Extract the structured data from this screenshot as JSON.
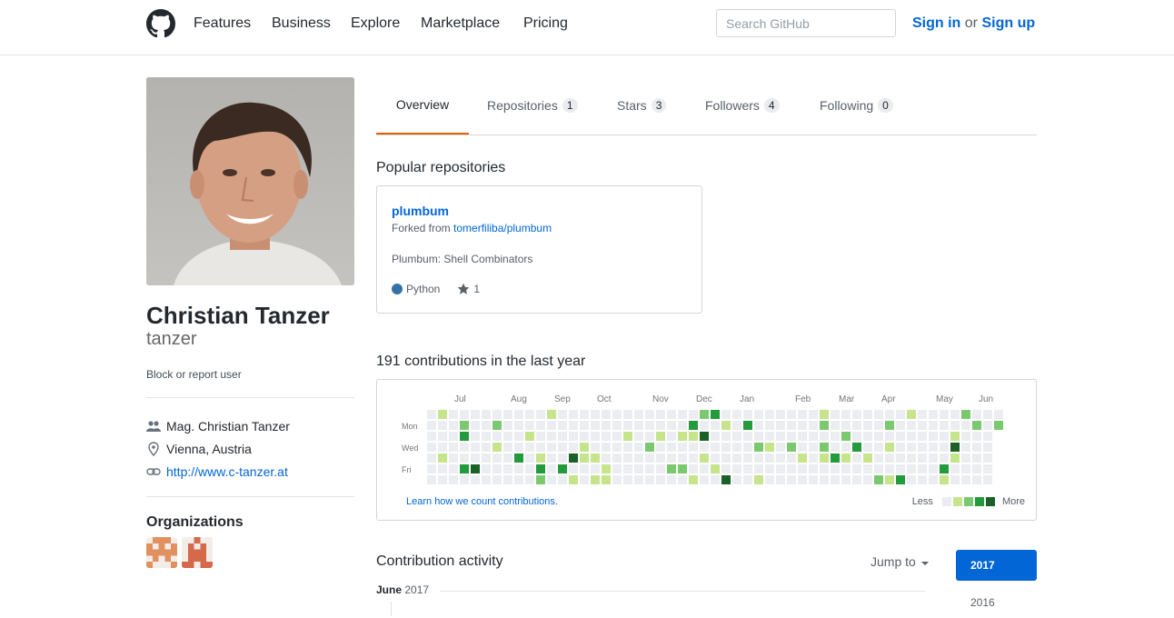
{
  "header": {
    "nav": [
      "Features",
      "Business",
      "Explore",
      "Marketplace",
      "Pricing"
    ],
    "search_placeholder": "Search GitHub",
    "sign_in": "Sign in",
    "or": "or",
    "sign_up": "Sign up"
  },
  "profile": {
    "full_name": "Christian Tanzer",
    "username": "tanzer",
    "block_report": "Block or report user",
    "details": {
      "company": "Mag. Christian Tanzer",
      "location": "Vienna, Austria",
      "website": "http://www.c-tanzer.at"
    },
    "organizations_heading": "Organizations"
  },
  "tabs": [
    {
      "label": "Overview",
      "count": null
    },
    {
      "label": "Repositories",
      "count": "1"
    },
    {
      "label": "Stars",
      "count": "3"
    },
    {
      "label": "Followers",
      "count": "4"
    },
    {
      "label": "Following",
      "count": "0"
    }
  ],
  "popular": {
    "heading": "Popular repositories",
    "repo": {
      "name": "plumbum",
      "forked_prefix": "Forked from",
      "forked_from": "tomerfiliba/plumbum",
      "description": "Plumbum: Shell Combinators",
      "language": "Python",
      "language_color": "#3572A5",
      "stars": "1"
    }
  },
  "contributions": {
    "heading": "191 contributions in the last year",
    "months": [
      "Jul",
      "Aug",
      "Sep",
      "Oct",
      "Nov",
      "Dec",
      "Jan",
      "Feb",
      "Mar",
      "Apr",
      "May",
      "Jun"
    ],
    "day_labels": [
      "Mon",
      "Wed",
      "Fri"
    ],
    "learn_link": "Learn how we count contributions.",
    "legend_less": "Less",
    "legend_more": "More",
    "colors": [
      "#ebedf0",
      "#c6e48b",
      "#7bc96f",
      "#239a3b",
      "#196127"
    ]
  },
  "activity": {
    "heading": "Contribution activity",
    "jump_to": "Jump to",
    "years": [
      "2017",
      "2016"
    ],
    "month": "June",
    "year": "2017"
  },
  "icons": {
    "logo": "github-logo-icon",
    "company": "people-icon",
    "location": "location-pin-icon",
    "website": "link-icon",
    "star": "star-icon",
    "caret": "caret-down-icon"
  }
}
